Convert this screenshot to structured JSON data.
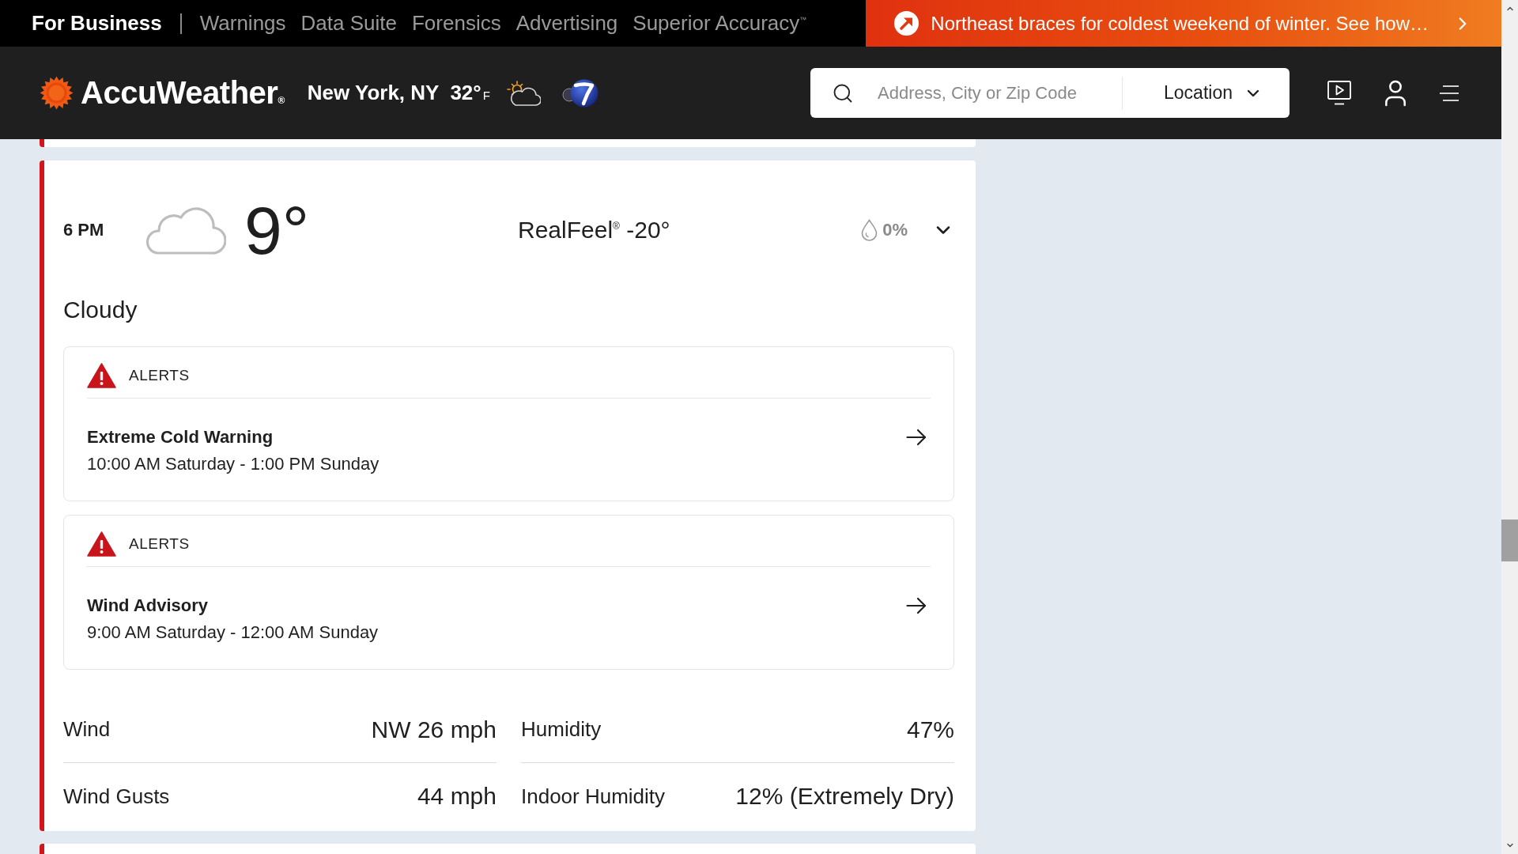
{
  "top_nav": {
    "links": [
      {
        "label": "For Business",
        "kind": "business"
      },
      {
        "label": "Warnings",
        "kind": "link"
      },
      {
        "label": "Data Suite",
        "kind": "link"
      },
      {
        "label": "Forensics",
        "kind": "link"
      },
      {
        "label": "Advertising",
        "kind": "link"
      },
      {
        "label": "Superior Accuracy$^{™}$",
        "kind": "link"
      }
    ]
  },
  "banner": {
    "headline": "Northeast braces for coldest weekend of winter. See how…"
  },
  "header": {
    "brand": "AccuWeather$_{®}$",
    "location": "New York, NY",
    "temperature": "32°",
    "unit": "F",
    "search": {
      "placeholder": "Address, City or Zip Code"
    },
    "location_button": "Location"
  },
  "hourly_forecast": {
    "time": "6 PM",
    "temperature": "9°",
    "realfeel": "RealFeel$^{®}$ -20°",
    "precipitation": "0%",
    "condition": "Cloudy",
    "alerts": [
      {
        "heading": "ALERTS",
        "title": "Extreme Cold Warning",
        "period": "10:00 AM Saturday - 1:00 PM Sunday"
      },
      {
        "heading": "ALERTS",
        "title": "Wind Advisory",
        "period": "9:00 AM Saturday - 12:00 AM Sunday"
      }
    ],
    "details": [
      {
        "label": "Wind",
        "value": "NW 26 mph"
      },
      {
        "label": "Humidity",
        "value": "47%"
      },
      {
        "label": "Wind Gusts",
        "value": "44 mph"
      },
      {
        "label": "Indoor Humidity",
        "value": "12% (Extremely Dry)"
      }
    ]
  }
}
